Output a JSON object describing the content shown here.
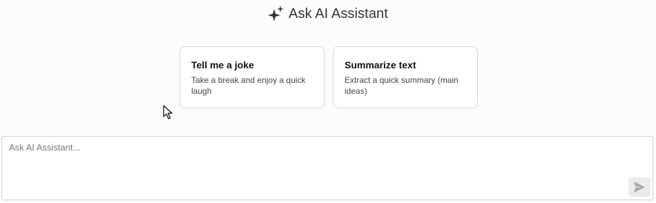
{
  "header": {
    "icon": "sparkle-icon",
    "title": "Ask AI Assistant"
  },
  "suggestions": [
    {
      "title": "Tell me a joke",
      "description": "Take a break and enjoy a quick laugh"
    },
    {
      "title": "Summarize text",
      "description": "Extract a quick summary (main ideas)"
    }
  ],
  "composer": {
    "placeholder": "Ask AI Assistant...",
    "value": "",
    "send_icon": "send-icon"
  },
  "colors": {
    "background": "#fcfcfb",
    "card_border": "#d6d6d6",
    "send_button_bg": "#ebebeb",
    "send_icon": "#a8a8a8"
  }
}
